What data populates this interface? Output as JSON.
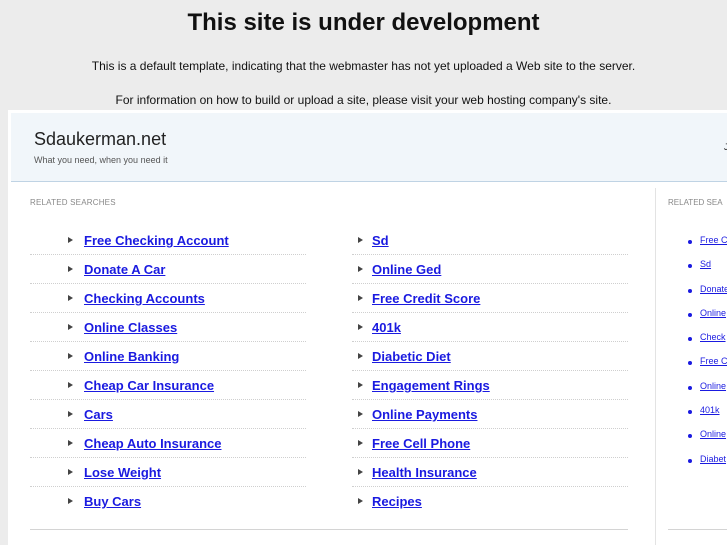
{
  "banner": {
    "title": "This site is under development",
    "message1": "This is a default template, indicating that the webmaster has not yet uploaded a Web site to the server.",
    "message2": "For information on how to build or upload a site, please visit your web hosting company's site."
  },
  "header": {
    "site_name": "Sdaukerman.net",
    "tagline": "What you need, when you need it",
    "right_text": "J"
  },
  "main": {
    "section_title": "RELATED SEARCHES",
    "left_column": [
      "Free Checking Account",
      "Donate A Car",
      "Checking Accounts",
      "Online Classes",
      "Online Banking",
      "Cheap Car Insurance",
      "Cars",
      "Cheap Auto Insurance",
      "Lose Weight",
      "Buy Cars"
    ],
    "right_column": [
      "Sd",
      "Online Ged",
      "Free Credit Score",
      "401k",
      "Diabetic Diet",
      "Engagement Rings",
      "Online Payments",
      "Free Cell Phone",
      "Health Insurance",
      "Recipes"
    ]
  },
  "sidebar": {
    "section_title": "RELATED SEA",
    "items": [
      "Free C",
      "Sd",
      "Donate",
      "Online",
      "Check",
      "Free C",
      "Online",
      "401k",
      "Online",
      "Diabet"
    ]
  },
  "icons": {
    "arrow": "arrow-right-icon",
    "bullet": "bullet-icon"
  },
  "colors": {
    "link": "#1a1ae0",
    "header_bg": "#f1f6fa",
    "page_bg": "#ececec"
  }
}
